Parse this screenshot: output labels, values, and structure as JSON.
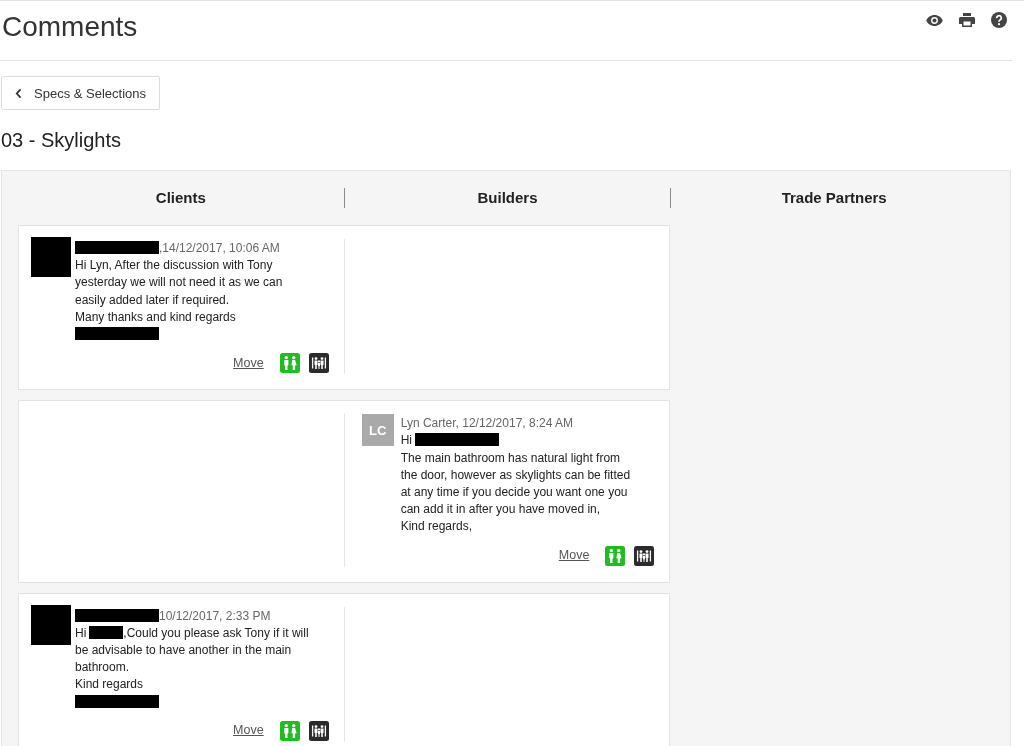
{
  "header": {
    "title": "Comments"
  },
  "back_button": {
    "label": "Specs & Selections"
  },
  "section_title": "03 - Skylights",
  "board": {
    "columns": [
      "Clients",
      "Builders",
      "Trade Partners"
    ],
    "comments": [
      {
        "kind": "client",
        "redacted": true,
        "meta": ",14/12/2017, 10:06 AM",
        "lines": [
          [
            {
              "kind": "text",
              "text": "Hi Lyn, After the discussion with Tony"
            }
          ],
          [
            {
              "kind": "text",
              "text": "yesterday we will not need it as we can"
            }
          ],
          [
            {
              "kind": "text",
              "text": "easily added later if required."
            }
          ],
          [
            {
              "kind": "text",
              "text": "Many thanks and kind regards"
            }
          ],
          [
            {
              "kind": "redaction"
            }
          ]
        ],
        "move_label": "Move",
        "share": [
          {
            "kind": "pair",
            "on": true
          },
          {
            "kind": "group",
            "on": false
          }
        ]
      },
      {
        "kind": "builder",
        "redacted": false,
        "initials": "LC",
        "meta": "Lyn Carter, 12/12/2017, 8:24 AM",
        "lines": [
          [
            {
              "kind": "text",
              "text": "Hi"
            },
            {
              "kind": "redaction"
            }
          ],
          [
            {
              "kind": "text",
              "text": "The main bathroom has natural light from"
            }
          ],
          [
            {
              "kind": "text",
              "text": "the door, however as skylights can be fitted"
            }
          ],
          [
            {
              "kind": "text",
              "text": "at any time if you decide you want one you"
            }
          ],
          [
            {
              "kind": "text",
              "text": "can add it in after you have moved in,"
            }
          ],
          [
            {
              "kind": "text",
              "text": "Kind regards,"
            }
          ]
        ],
        "move_label": "Move",
        "share": [
          {
            "kind": "pair",
            "on": true
          },
          {
            "kind": "group",
            "on": false
          }
        ]
      },
      {
        "kind": "client",
        "redacted": true,
        "meta": "10/12/2017, 2:33 PM",
        "lines": [
          [
            {
              "kind": "text",
              "text": "Hi"
            },
            {
              "kind": "redaction"
            },
            {
              "kind": "text",
              "text": ",Could you please ask Tony if it will"
            }
          ],
          [
            {
              "kind": "text",
              "text": "be advisable to have another in the main"
            }
          ],
          [
            {
              "kind": "text",
              "text": "bathroom."
            }
          ],
          [
            {
              "kind": "text",
              "text": "Kind regards"
            }
          ],
          [
            {
              "kind": "redaction"
            }
          ]
        ],
        "move_label": "Move",
        "share": [
          {
            "kind": "pair",
            "on": true
          },
          {
            "kind": "group",
            "on": false
          }
        ]
      }
    ]
  }
}
